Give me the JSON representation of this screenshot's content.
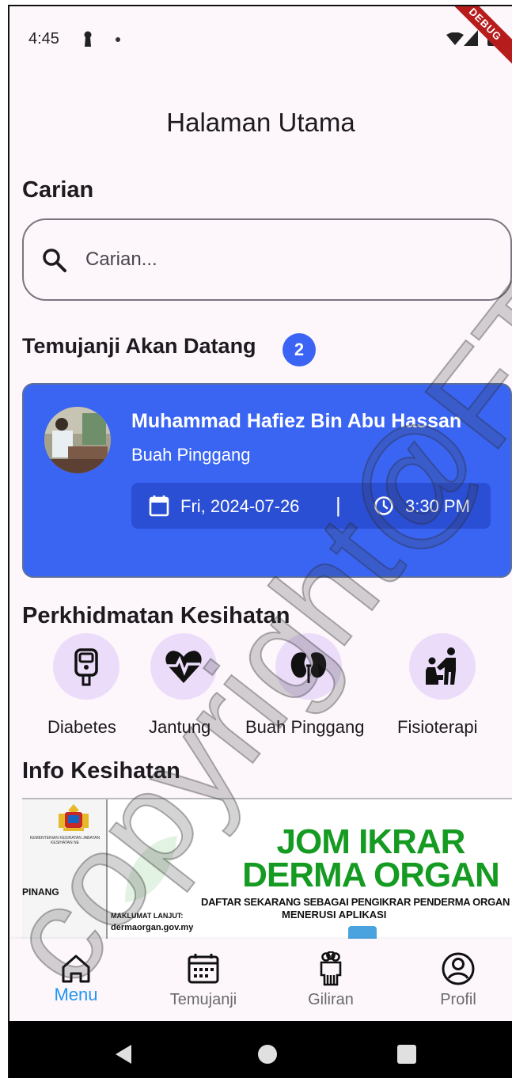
{
  "status_bar": {
    "time": "4:45",
    "debug_label": "DEBUG"
  },
  "page_title": "Halaman Utama",
  "search": {
    "title": "Carian",
    "placeholder": "Carian..."
  },
  "appointments": {
    "title": "Temujanji Akan Datang",
    "count": "2",
    "card": {
      "doctor_name": "Muhammad Hafiez Bin Abu Hassan",
      "specialty": "Buah Pinggang",
      "date": "Fri, 2024-07-26",
      "separator": "|",
      "time": "3:30 PM"
    }
  },
  "services": {
    "title": "Perkhidmatan Kesihatan",
    "items": [
      {
        "label": "Diabetes",
        "icon": "glucometer-icon"
      },
      {
        "label": "Jantung",
        "icon": "heart-pulse-icon"
      },
      {
        "label": "Buah Pinggang",
        "icon": "kidney-icon"
      },
      {
        "label": "Fisioterapi",
        "icon": "physiotherapy-icon"
      }
    ]
  },
  "info": {
    "title": "Info Kesihatan",
    "banner": {
      "ministry_text": "KEMENTERIAN KESIHATAN JABATAN KESIHATAN NE",
      "location": "PINANG",
      "headline1": "JOM IKRAR",
      "headline2": "DERMA ORGAN",
      "subline1": "DAFTAR SEKARANG SEBAGAI PENGIKRAR PENDERMA ORGAN",
      "subline2": "MENERUSI APLIKASI",
      "more_info": "MAKLUMAT LANJUT:",
      "website": "dermaorgan.gov.my"
    }
  },
  "bottom_nav": {
    "items": [
      {
        "label": "Menu",
        "icon": "home-icon",
        "active": true
      },
      {
        "label": "Temujanji",
        "icon": "calendar-icon",
        "active": false
      },
      {
        "label": "Giliran",
        "icon": "queue-icon",
        "active": false
      },
      {
        "label": "Profil",
        "icon": "profile-icon",
        "active": false
      }
    ]
  },
  "watermark": "copyright@FTSM UKM",
  "colors": {
    "primary": "#3a65f2",
    "active_nav": "#2196f3",
    "service_bg": "#ebddfa",
    "banner_green": "#159a22"
  }
}
